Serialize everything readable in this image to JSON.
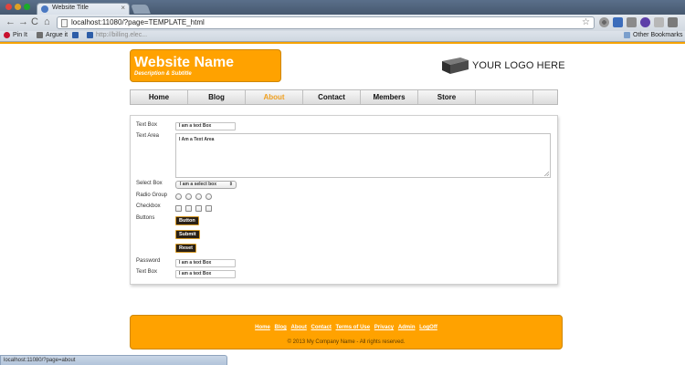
{
  "browser": {
    "tab_title": "Website Title",
    "tab_close": "×",
    "url": "localhost:11080/?page=TEMPLATE_html",
    "nav": {
      "back": "←",
      "forward": "→",
      "reload": "C",
      "home": "⌂"
    },
    "star": "☆",
    "bookmarks": [
      "Pin It",
      "Argue it",
      "W",
      "http://billing.elec..."
    ],
    "other_bookmarks": "Other Bookmarks",
    "status_url": "localhost:11080/?page=about"
  },
  "header": {
    "site_name": "Website Name",
    "description": "Description & Subtitle",
    "logo_text": "YOUR LOGO HERE"
  },
  "nav": {
    "items": [
      "Home",
      "Blog",
      "About",
      "Contact",
      "Members",
      "Store",
      ""
    ],
    "active": "About"
  },
  "form": {
    "textbox_label": "Text Box",
    "textbox_value": "I am a text Box",
    "textarea_label": "Text Area",
    "textarea_value": "I Am a Text Area",
    "select_label": "Select Box",
    "select_value": "I am a select box",
    "select_arrow": "⇕",
    "radio_label": "Radio Group",
    "checkbox_label": "Checkbox",
    "buttons_label": "Buttons",
    "buttons": [
      "Button",
      "Submit",
      "Reset"
    ],
    "password_label": "Password",
    "password_value": "I am a text Box",
    "textbox2_label": "Text Box",
    "textbox2_value": "I am a text Box"
  },
  "footer": {
    "links": [
      "Home",
      "Blog",
      "About",
      "Contact",
      "Terms of Use",
      "Privacy",
      "Admin",
      "LogOff"
    ],
    "copyright": "© 2013 My Company Name - All rights reserved."
  },
  "colors": {
    "accent": "#ffa200",
    "nav_active": "#f0a020",
    "button_bg": "#2a2015"
  }
}
